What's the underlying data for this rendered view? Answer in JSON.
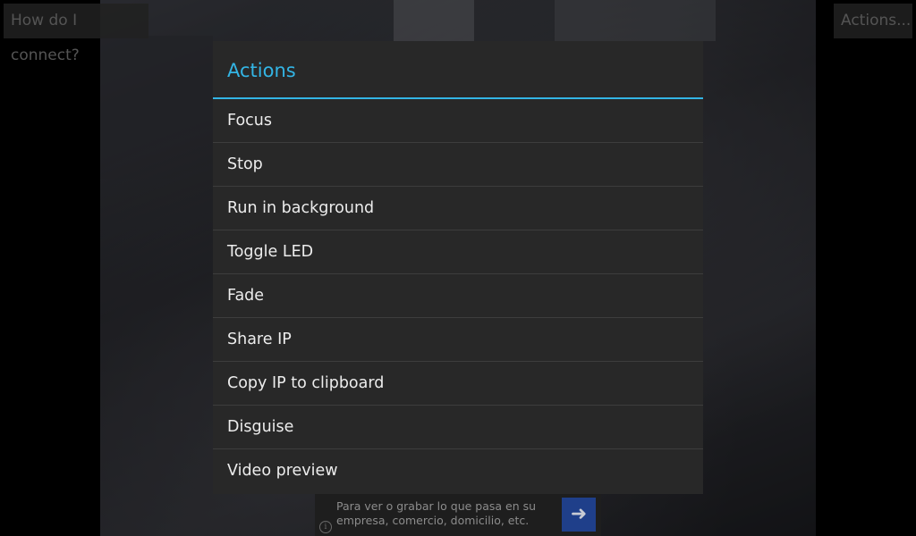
{
  "top_bar": {
    "how_label": "How do I connect?",
    "actions_label": "Actions..."
  },
  "dialog": {
    "title": "Actions",
    "items": [
      {
        "label": "Focus"
      },
      {
        "label": "Stop"
      },
      {
        "label": "Run in background"
      },
      {
        "label": "Toggle LED"
      },
      {
        "label": "Fade"
      },
      {
        "label": "Share IP"
      },
      {
        "label": "Copy IP to clipboard"
      },
      {
        "label": "Disguise"
      },
      {
        "label": "Video preview"
      }
    ]
  },
  "ad": {
    "text": "Para ver o grabar lo que pasa en su empresa, comercio, domicilio, etc.",
    "arrow_icon": "arrow-right-icon",
    "info_icon": "info-icon"
  },
  "colors": {
    "accent": "#33b5e5",
    "dialog_bg": "#282828",
    "ad_button": "#1f3f8a"
  }
}
